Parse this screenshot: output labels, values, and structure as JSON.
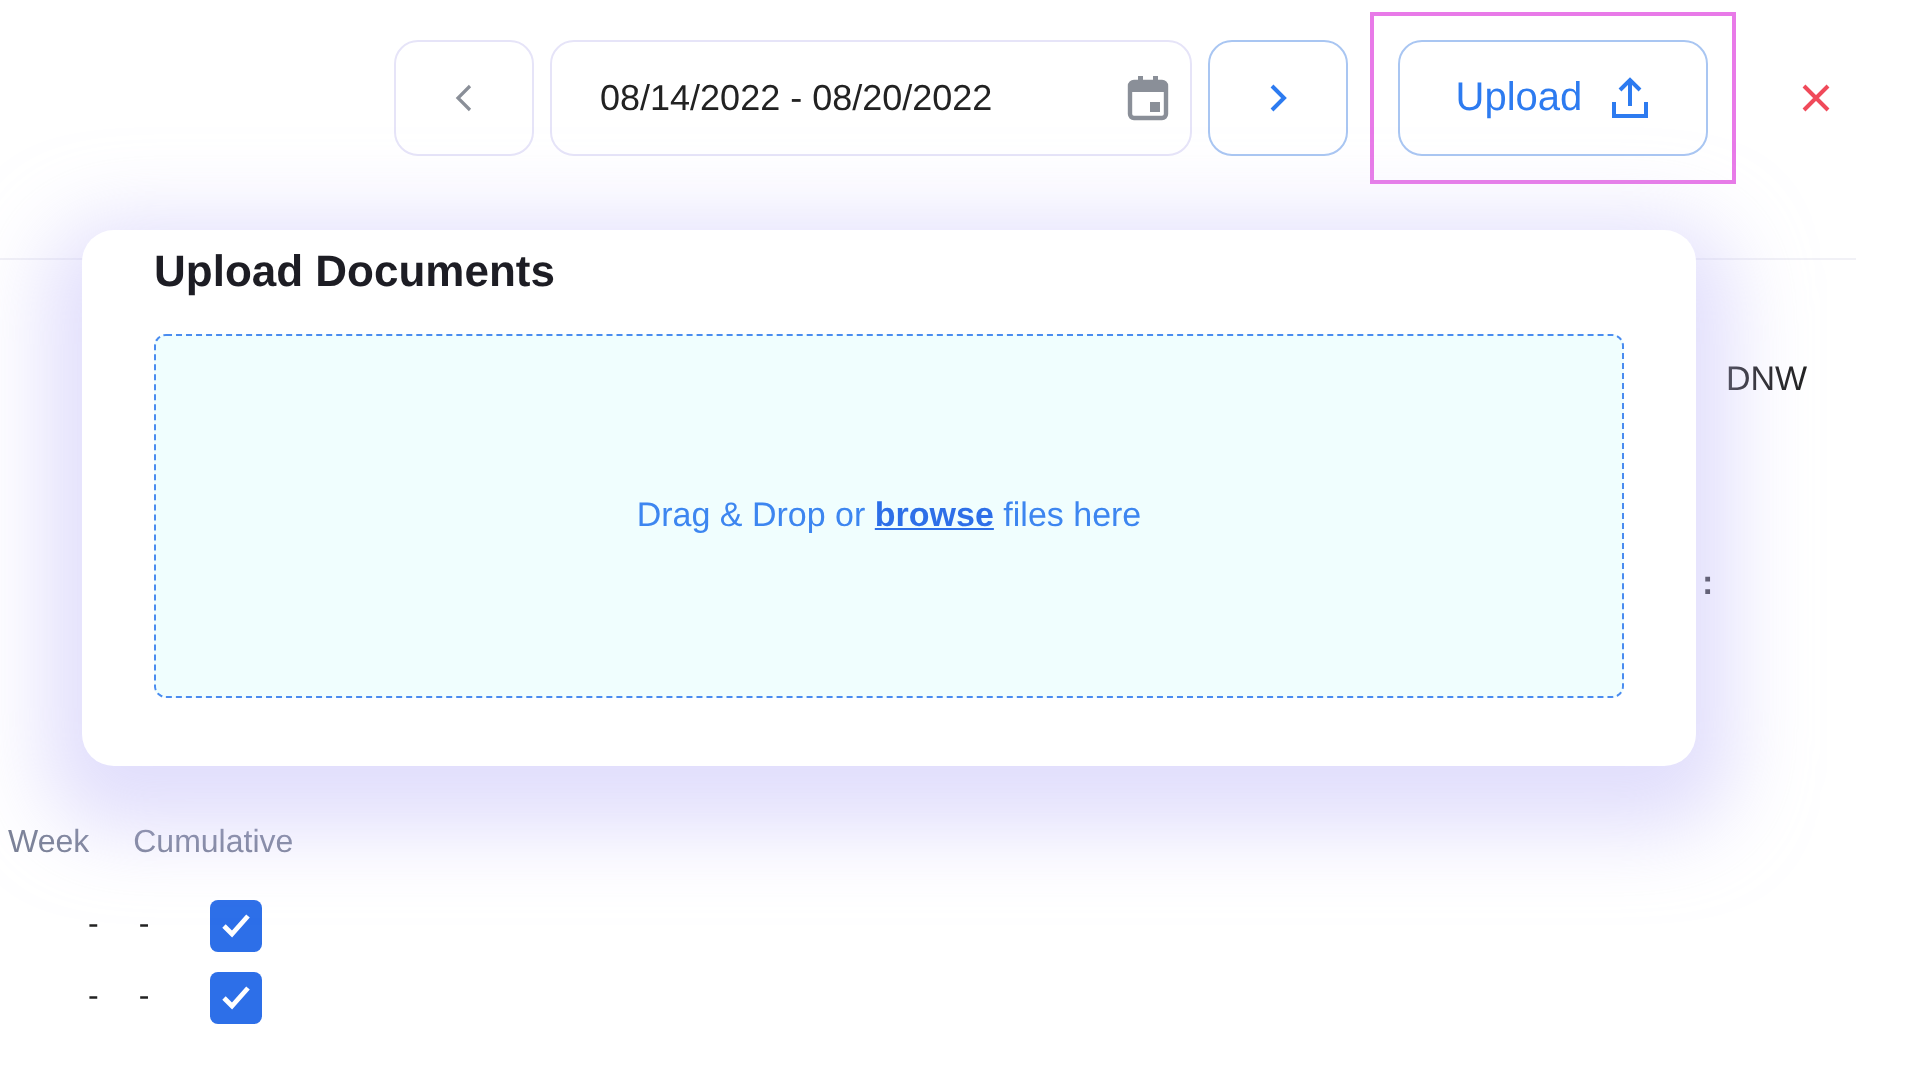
{
  "toolbar": {
    "date_range": "08/14/2022 - 08/20/2022",
    "upload_label": "Upload",
    "upload_highlighted": true
  },
  "dialog": {
    "title": "Upload Documents",
    "dropzone": {
      "text_before": "Drag & Drop or ",
      "link": "browse",
      "text_after": " files here"
    }
  },
  "background": {
    "header_label": "DNW",
    "separator": ":",
    "columns": [
      "Week",
      "Cumulative"
    ],
    "rows": [
      {
        "cells": [
          "-",
          "-"
        ],
        "checked": true
      },
      {
        "cells": [
          "-",
          "-"
        ],
        "checked": true
      }
    ]
  }
}
